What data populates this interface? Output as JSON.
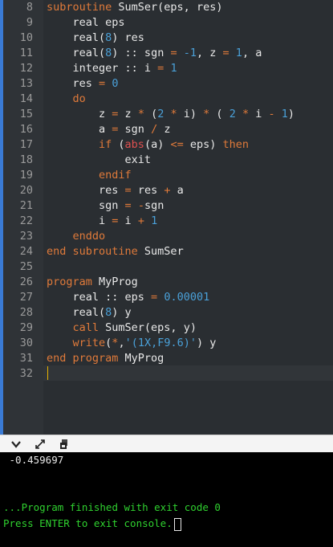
{
  "editor": {
    "line_numbers": [
      "8",
      "9",
      "10",
      "11",
      "12",
      "13",
      "14",
      "15",
      "16",
      "17",
      "18",
      "19",
      "20",
      "21",
      "22",
      "23",
      "24",
      "25",
      "26",
      "27",
      "28",
      "29",
      "30",
      "31",
      "32"
    ],
    "lines": [
      [
        {
          "t": "subroutine",
          "c": "kw"
        },
        {
          "t": " SumSer(eps, res)",
          "c": "txt"
        }
      ],
      [
        {
          "t": "    real eps",
          "c": "txt"
        }
      ],
      [
        {
          "t": "    real(",
          "c": "txt"
        },
        {
          "t": "8",
          "c": "num"
        },
        {
          "t": ") res",
          "c": "txt"
        }
      ],
      [
        {
          "t": "    real(",
          "c": "txt"
        },
        {
          "t": "8",
          "c": "num"
        },
        {
          "t": ") :: sgn ",
          "c": "txt"
        },
        {
          "t": "=",
          "c": "op"
        },
        {
          "t": " ",
          "c": "txt"
        },
        {
          "t": "-1",
          "c": "num"
        },
        {
          "t": ", z ",
          "c": "txt"
        },
        {
          "t": "=",
          "c": "op"
        },
        {
          "t": " ",
          "c": "txt"
        },
        {
          "t": "1",
          "c": "num"
        },
        {
          "t": ", a",
          "c": "txt"
        }
      ],
      [
        {
          "t": "    integer :: i ",
          "c": "txt"
        },
        {
          "t": "=",
          "c": "op"
        },
        {
          "t": " ",
          "c": "txt"
        },
        {
          "t": "1",
          "c": "num"
        }
      ],
      [
        {
          "t": "    res ",
          "c": "txt"
        },
        {
          "t": "=",
          "c": "op"
        },
        {
          "t": " ",
          "c": "txt"
        },
        {
          "t": "0",
          "c": "num"
        }
      ],
      [
        {
          "t": "    do",
          "c": "kw"
        }
      ],
      [
        {
          "t": "        z ",
          "c": "txt"
        },
        {
          "t": "=",
          "c": "op"
        },
        {
          "t": " z ",
          "c": "txt"
        },
        {
          "t": "*",
          "c": "op"
        },
        {
          "t": " (",
          "c": "txt"
        },
        {
          "t": "2",
          "c": "num"
        },
        {
          "t": " ",
          "c": "txt"
        },
        {
          "t": "*",
          "c": "op"
        },
        {
          "t": " i) ",
          "c": "txt"
        },
        {
          "t": "*",
          "c": "op"
        },
        {
          "t": " ( ",
          "c": "txt"
        },
        {
          "t": "2",
          "c": "num"
        },
        {
          "t": " ",
          "c": "txt"
        },
        {
          "t": "*",
          "c": "op"
        },
        {
          "t": " i ",
          "c": "txt"
        },
        {
          "t": "-",
          "c": "op"
        },
        {
          "t": " ",
          "c": "txt"
        },
        {
          "t": "1",
          "c": "num"
        },
        {
          "t": ")",
          "c": "txt"
        }
      ],
      [
        {
          "t": "        a ",
          "c": "txt"
        },
        {
          "t": "=",
          "c": "op"
        },
        {
          "t": " sgn ",
          "c": "txt"
        },
        {
          "t": "/",
          "c": "op"
        },
        {
          "t": " z",
          "c": "txt"
        }
      ],
      [
        {
          "t": "        if",
          "c": "kw"
        },
        {
          "t": " (",
          "c": "txt"
        },
        {
          "t": "abs",
          "c": "fn"
        },
        {
          "t": "(a) ",
          "c": "txt"
        },
        {
          "t": "<=",
          "c": "op"
        },
        {
          "t": " eps) ",
          "c": "txt"
        },
        {
          "t": "then",
          "c": "kw"
        }
      ],
      [
        {
          "t": "            exit",
          "c": "txt"
        }
      ],
      [
        {
          "t": "        endif",
          "c": "kw"
        }
      ],
      [
        {
          "t": "        res ",
          "c": "txt"
        },
        {
          "t": "=",
          "c": "op"
        },
        {
          "t": " res ",
          "c": "txt"
        },
        {
          "t": "+",
          "c": "op"
        },
        {
          "t": " a",
          "c": "txt"
        }
      ],
      [
        {
          "t": "        sgn ",
          "c": "txt"
        },
        {
          "t": "=",
          "c": "op"
        },
        {
          "t": " ",
          "c": "txt"
        },
        {
          "t": "-",
          "c": "op"
        },
        {
          "t": "sgn",
          "c": "txt"
        }
      ],
      [
        {
          "t": "        i ",
          "c": "txt"
        },
        {
          "t": "=",
          "c": "op"
        },
        {
          "t": " i ",
          "c": "txt"
        },
        {
          "t": "+",
          "c": "op"
        },
        {
          "t": " ",
          "c": "txt"
        },
        {
          "t": "1",
          "c": "num"
        }
      ],
      [
        {
          "t": "    enddo",
          "c": "kw"
        }
      ],
      [
        {
          "t": "end subroutine",
          "c": "kw"
        },
        {
          "t": " SumSer",
          "c": "txt"
        }
      ],
      [],
      [
        {
          "t": "program",
          "c": "kw"
        },
        {
          "t": " MyProg",
          "c": "txt"
        }
      ],
      [
        {
          "t": "    real :: eps ",
          "c": "txt"
        },
        {
          "t": "=",
          "c": "op"
        },
        {
          "t": " ",
          "c": "txt"
        },
        {
          "t": "0.00001",
          "c": "num"
        }
      ],
      [
        {
          "t": "    real(",
          "c": "txt"
        },
        {
          "t": "8",
          "c": "num"
        },
        {
          "t": ") y",
          "c": "txt"
        }
      ],
      [
        {
          "t": "    call",
          "c": "kw"
        },
        {
          "t": " SumSer(eps, y)",
          "c": "txt"
        }
      ],
      [
        {
          "t": "    write",
          "c": "kw"
        },
        {
          "t": "(",
          "c": "txt"
        },
        {
          "t": "*",
          "c": "op"
        },
        {
          "t": ",",
          "c": "txt"
        },
        {
          "t": "'(1X,F9.6)'",
          "c": "str"
        },
        {
          "t": ") y",
          "c": "txt"
        }
      ],
      [
        {
          "t": "end program",
          "c": "kw"
        },
        {
          "t": " MyProg",
          "c": "txt"
        }
      ],
      []
    ]
  },
  "toolbar": {
    "icons": [
      "chevron-down-icon",
      "expand-icon",
      "copy-icon"
    ]
  },
  "console": {
    "output": " -0.459697",
    "finished": "...Program finished with exit code 0",
    "press_enter": "Press ENTER to exit console."
  }
}
